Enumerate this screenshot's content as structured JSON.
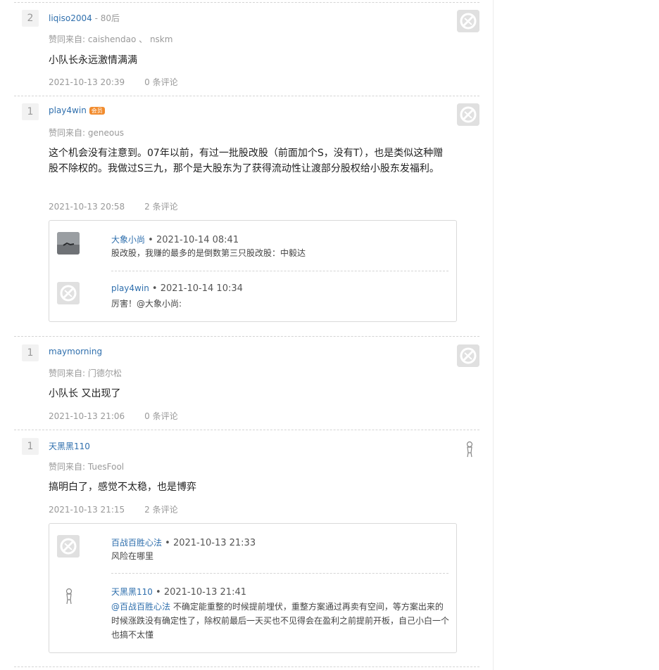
{
  "answers": [
    {
      "votes": "2",
      "user": "liqiso2004",
      "user_desc": "80后",
      "upvoters_label": "赞同来自:",
      "upvoters": "caishendao 、 nskm",
      "content": "小队长永远激情满满",
      "time": "2021-10-13 20:39",
      "comments": "0 条评论"
    },
    {
      "votes": "1",
      "user": "play4win",
      "badge": "会员",
      "upvoters_label": "赞同来自:",
      "upvoters": "geneous",
      "content": "这个机会没有注意到。07年以前，有过一批股改股（前面加个S，没有T），也是类似这种赠股不除权的。我做过S三九，那个是大股东为了获得流动性让渡部分股权给小股东发福利。",
      "time": "2021-10-13 20:58",
      "comments": "2 条评论",
      "replies": [
        {
          "user": "大象小尚",
          "time": "2021-10-14 08:41",
          "text": "股改股，我赚的最多的是倒数第三只股改股：中毅达"
        },
        {
          "user": "play4win",
          "time": "2021-10-14 10:34",
          "text": "厉害！@大象小尚:"
        }
      ]
    },
    {
      "votes": "1",
      "user": "maymorning",
      "upvoters_label": "赞同来自:",
      "upvoters": "门德尔松",
      "content": "小队长 又出现了",
      "time": "2021-10-13 21:06",
      "comments": "0 条评论"
    },
    {
      "votes": "1",
      "user": "天黑黑110",
      "upvoters_label": "赞同来自:",
      "upvoters": "TuesFool",
      "content": "搞明白了，感觉不太稳，也是博弈",
      "time": "2021-10-13 21:15",
      "comments": "2 条评论",
      "replies": [
        {
          "user": "百战百胜心法",
          "time": "2021-10-13 21:33",
          "text": "风险在哪里"
        },
        {
          "user": "天黑黑110",
          "time": "2021-10-13 21:41",
          "mention": "@百战百胜心法",
          "text": " 不确定能重整的时候提前埋伏，重整方案通过再卖有空间，等方案出来的时候涨跌没有确定性了，除权前最后一天买也不见得会在盈利之前提前开板，自己小白一个也搞不太懂"
        }
      ]
    }
  ],
  "separator": " • ",
  "dash": " - ",
  "icons": {
    "default_avatar": "default-avatar-icon",
    "figure_avatar": "figure-avatar-icon"
  },
  "colors": {
    "link": "#2f6fad",
    "muted": "#999999",
    "badge": "#f28c2e"
  }
}
